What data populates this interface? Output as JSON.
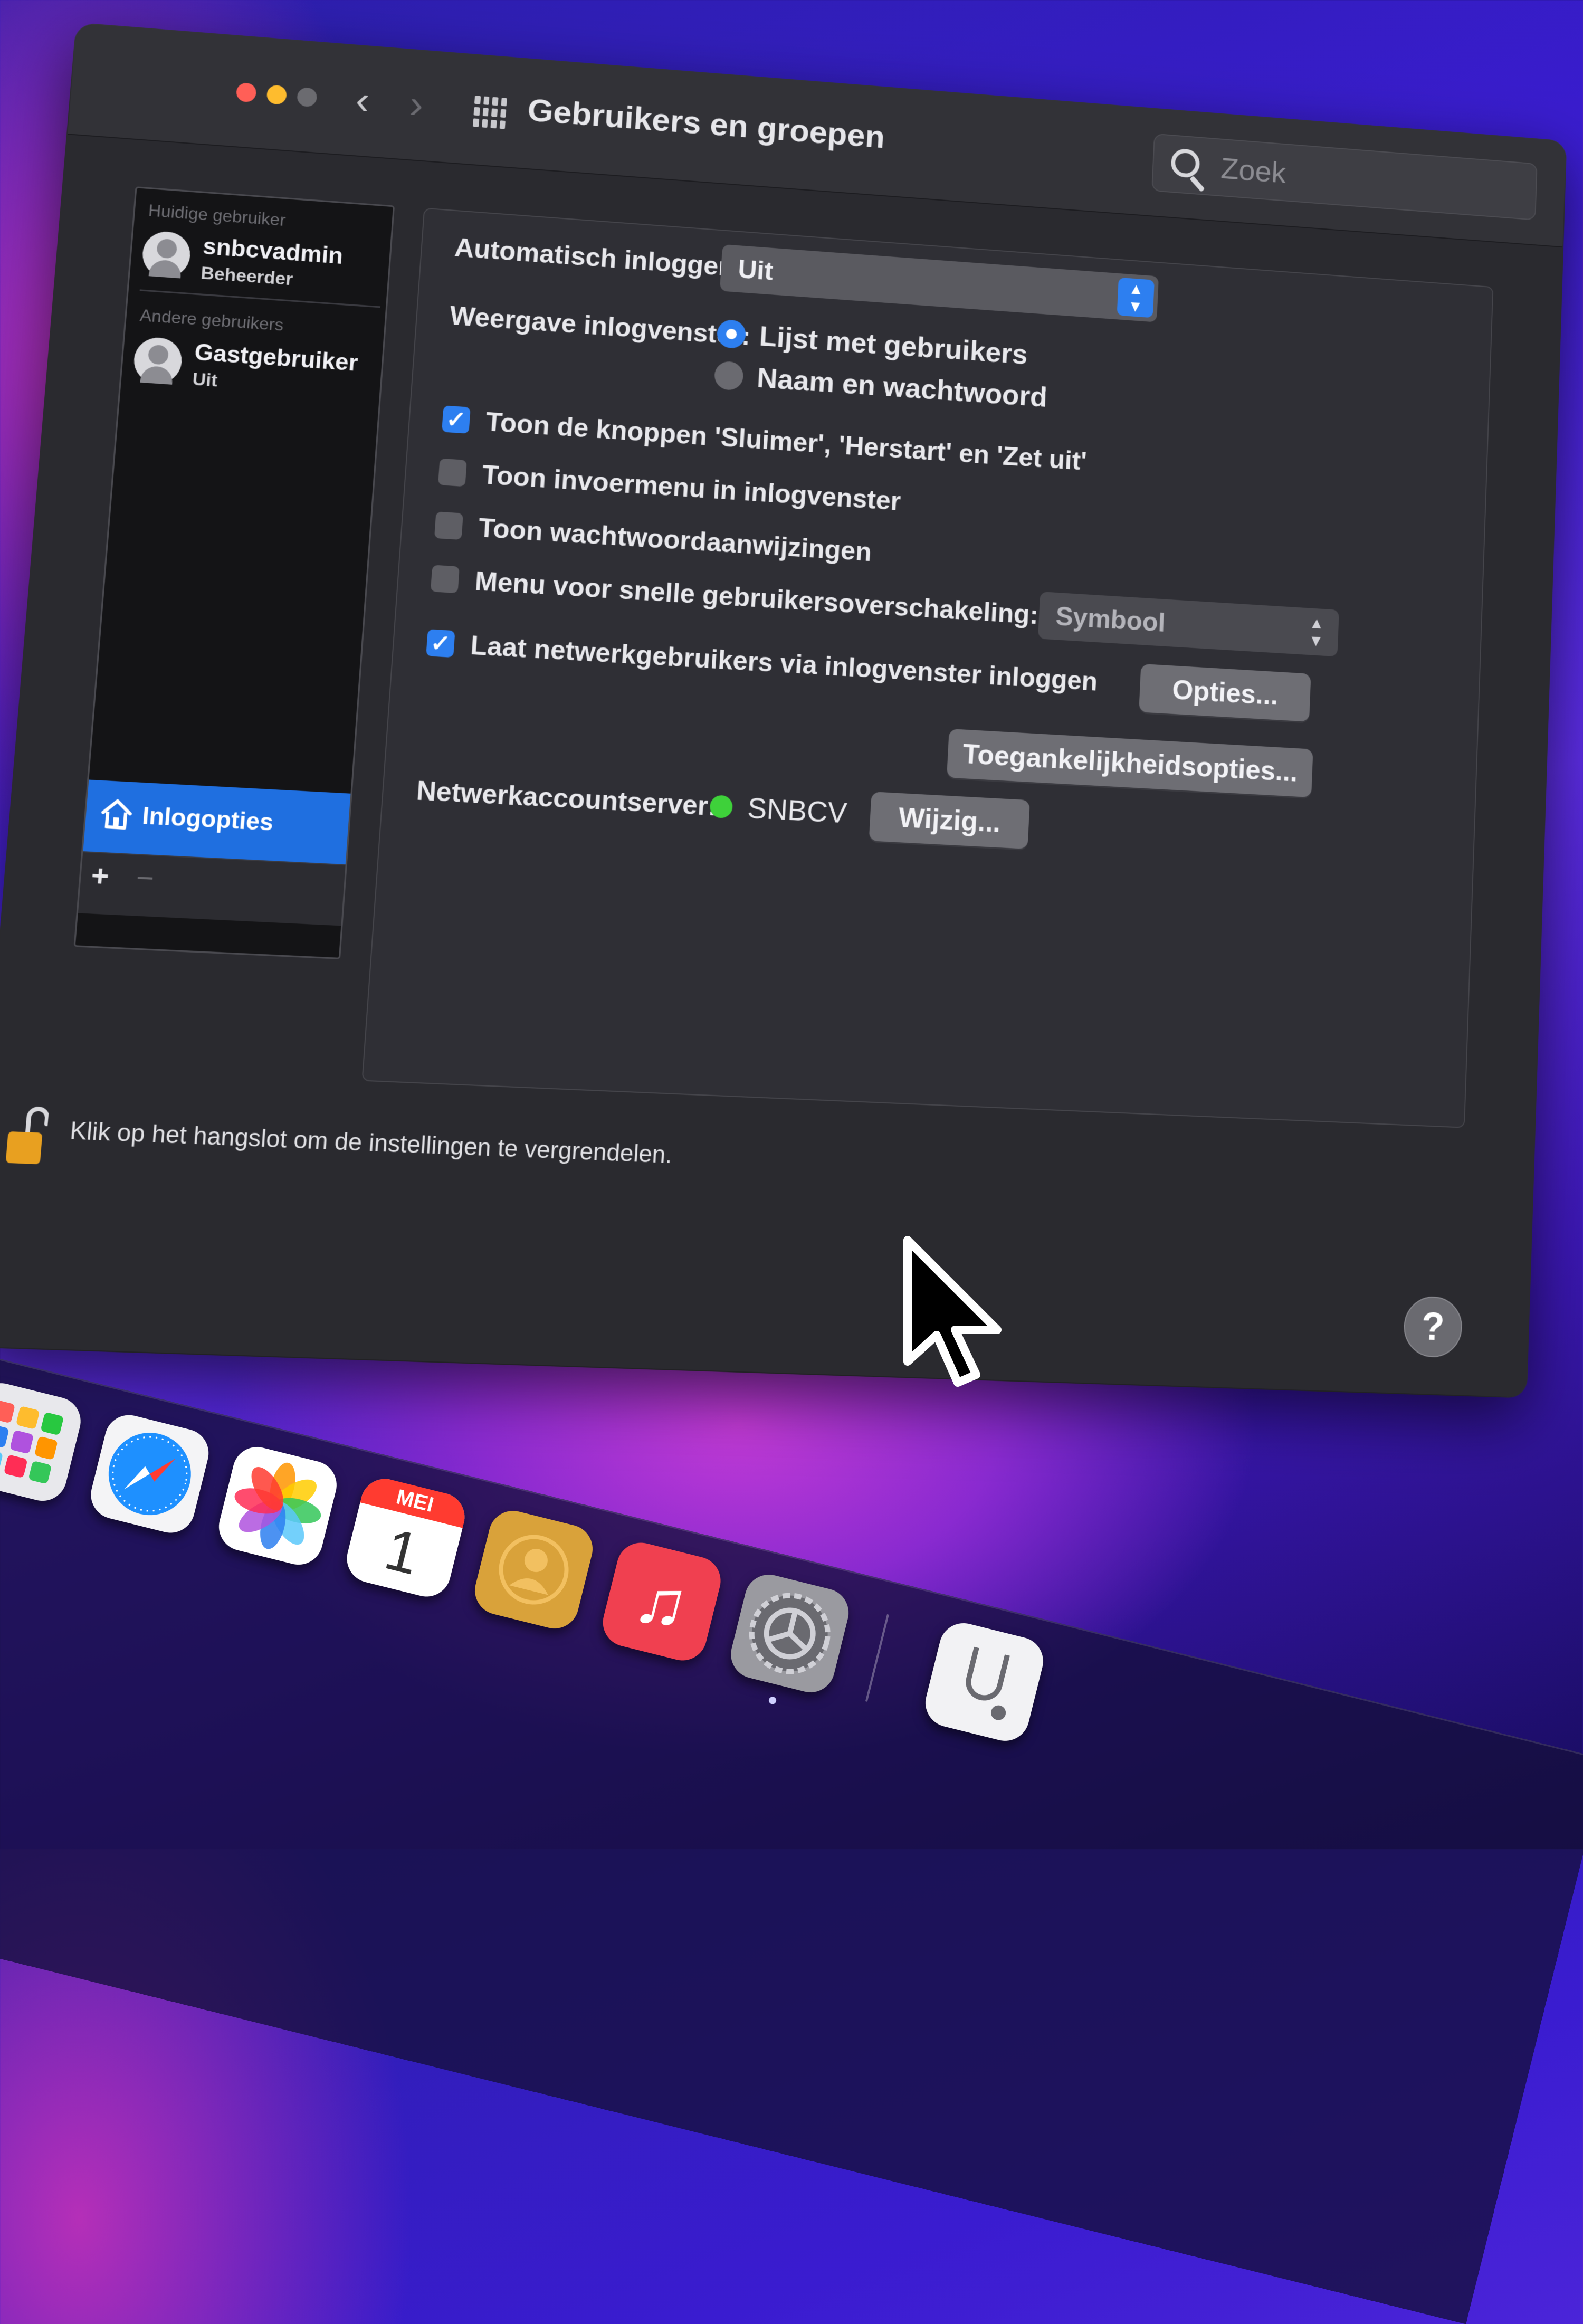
{
  "window": {
    "title": "Gebruikers en groepen",
    "search_placeholder": "Zoek"
  },
  "sidebar": {
    "current_section": "Huidige gebruiker",
    "current_user": {
      "name": "snbcvadmin",
      "role": "Beheerder"
    },
    "other_section": "Andere gebruikers",
    "other_users": [
      {
        "name": "Gastgebruiker",
        "status": "Uit"
      }
    ],
    "login_options": "Inlogopties",
    "add": "+",
    "remove": "−"
  },
  "login": {
    "auto_login_label": "Automatisch inloggen:",
    "auto_login_value": "Uit",
    "display_label": "Weergave inlogvenster:",
    "display_options": [
      "Lijst met gebruikers",
      "Naam en wachtwoord"
    ],
    "display_selected": "Lijst met gebruikers",
    "checkboxes": [
      {
        "label": "Toon de knoppen 'Sluimer', 'Herstart' en 'Zet uit'",
        "checked": true
      },
      {
        "label": "Toon invoermenu in inlogvenster",
        "checked": false
      },
      {
        "label": "Toon wachtwoordaanwijzingen",
        "checked": false
      },
      {
        "label": "Menu voor snelle gebruikersoverschakeling:",
        "checked": false
      },
      {
        "label": "Laat netwerkgebruikers via inlogvenster inloggen",
        "checked": true
      }
    ],
    "fast_switch_value": "Symbool",
    "options_button": "Opties...",
    "accessibility_button": "Toegankelijkheidsopties...",
    "network_server_label": "Netwerkaccountserver:",
    "network_server_name": "SNBCV",
    "network_server_status_color": "#3ed13a",
    "change_button": "Wijzig..."
  },
  "footer": {
    "lock_text": "Klik op het hangslot om de instellingen te vergrendelen.",
    "help": "?"
  },
  "dock": {
    "apps": [
      "launchpad-icon",
      "safari-icon",
      "photos-icon",
      "calendar-icon",
      "contacts-icon",
      "music-icon",
      "settings-icon",
      "utility-icon"
    ],
    "calendar_month": "MEI",
    "calendar_day": "1"
  },
  "colors": {
    "accent": "#2d7ff0",
    "window_bg": "#2a2a2f",
    "selected_row": "#1f6fe0"
  }
}
